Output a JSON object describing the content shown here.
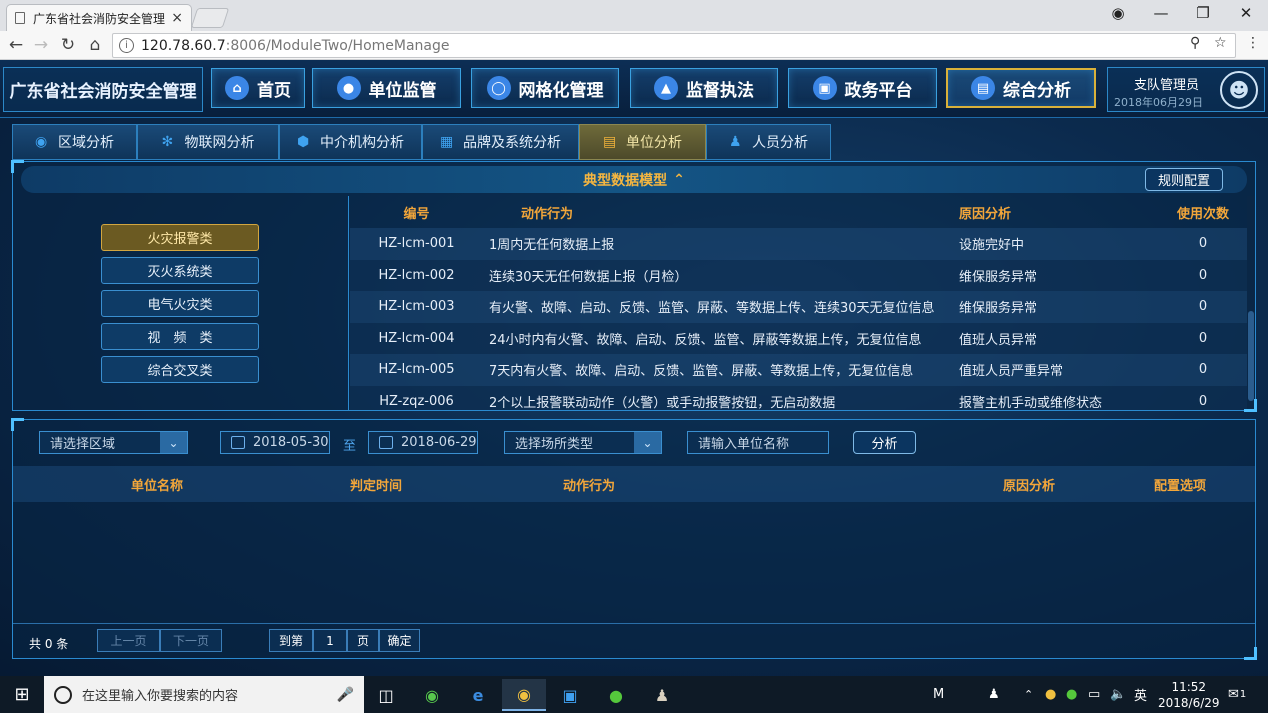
{
  "browser": {
    "tab_title": "广东省社会消防安全管理",
    "tab_close": "×",
    "url_host": "120.78.60.7",
    "url_path": ":8006/ModuleTwo/HomeManage"
  },
  "header": {
    "brand": "广东省社会消防安全管理",
    "nav": [
      {
        "label": "首页",
        "icon": "home-icon"
      },
      {
        "label": "单位监管",
        "icon": "users-icon"
      },
      {
        "label": "网格化管理",
        "icon": "grid-globe-icon"
      },
      {
        "label": "监督执法",
        "icon": "police-cap-icon"
      },
      {
        "label": "政务平台",
        "icon": "screen-icon"
      },
      {
        "label": "综合分析",
        "icon": "chart-icon",
        "active": true
      }
    ],
    "user_name": "支队管理员",
    "user_date": "2018年06月29日"
  },
  "subtabs": [
    {
      "label": "区域分析",
      "icon": "location-pin-icon"
    },
    {
      "label": "物联网分析",
      "icon": "network-icon"
    },
    {
      "label": "中介机构分析",
      "icon": "cube-icon"
    },
    {
      "label": "品牌及系统分析",
      "icon": "calendar-icon"
    },
    {
      "label": "单位分析",
      "icon": "building-icon",
      "active": true
    },
    {
      "label": "人员分析",
      "icon": "people-icon"
    }
  ],
  "model_panel": {
    "title": "典型数据模型",
    "rule_button": "规则配置",
    "categories": [
      {
        "label": "火灾报警类",
        "active": true
      },
      {
        "label": "灭火系统类"
      },
      {
        "label": "电气火灾类"
      },
      {
        "label": "视　频　类"
      },
      {
        "label": "综合交叉类"
      }
    ],
    "columns": [
      "编号",
      "动作行为",
      "原因分析",
      "使用次数"
    ],
    "rows": [
      {
        "id": "HZ-lcm-001",
        "action": "1周内无任何数据上报",
        "reason": "设施完好中",
        "count": "0"
      },
      {
        "id": "HZ-lcm-002",
        "action": "连续30天无任何数据上报（月检）",
        "reason": "维保服务异常",
        "count": "0"
      },
      {
        "id": "HZ-lcm-003",
        "action": "有火警、故障、启动、反馈、监管、屏蔽、等数据上传、连续30天无复位信息",
        "reason": "维保服务异常",
        "count": "0"
      },
      {
        "id": "HZ-lcm-004",
        "action": "24小时内有火警、故障、启动、反馈、监管、屏蔽等数据上传，无复位信息",
        "reason": "值班人员异常",
        "count": "0"
      },
      {
        "id": "HZ-lcm-005",
        "action": "7天内有火警、故障、启动、反馈、监管、屏蔽、等数据上传，无复位信息",
        "reason": "值班人员严重异常",
        "count": "0"
      },
      {
        "id": "HZ-zqz-006",
        "action": "2个以上报警联动动作（火警）或手动报警按钮，无启动数据",
        "reason": "报警主机手动或维修状态",
        "count": "0"
      }
    ]
  },
  "filter": {
    "region_placeholder": "请选择区域",
    "date_from": "2018-05-30",
    "to_label": "至",
    "date_to": "2018-06-29",
    "venue_placeholder": "选择场所类型",
    "unit_placeholder": "请输入单位名称",
    "analyze_button": "分析"
  },
  "result_table": {
    "columns": [
      "单位名称",
      "判定时间",
      "动作行为",
      "原因分析",
      "配置选项"
    ]
  },
  "pagination": {
    "total": "共 0 条",
    "prev": "上一页",
    "next": "下一页",
    "goto": "到第",
    "page_value": "1",
    "page_unit": "页",
    "confirm": "确定"
  },
  "taskbar": {
    "search_placeholder": "在这里输入你要搜索的内容",
    "ime_m": "M",
    "lang": "英",
    "time": "11:52",
    "date": "2018/6/29",
    "notif_count": "1"
  }
}
